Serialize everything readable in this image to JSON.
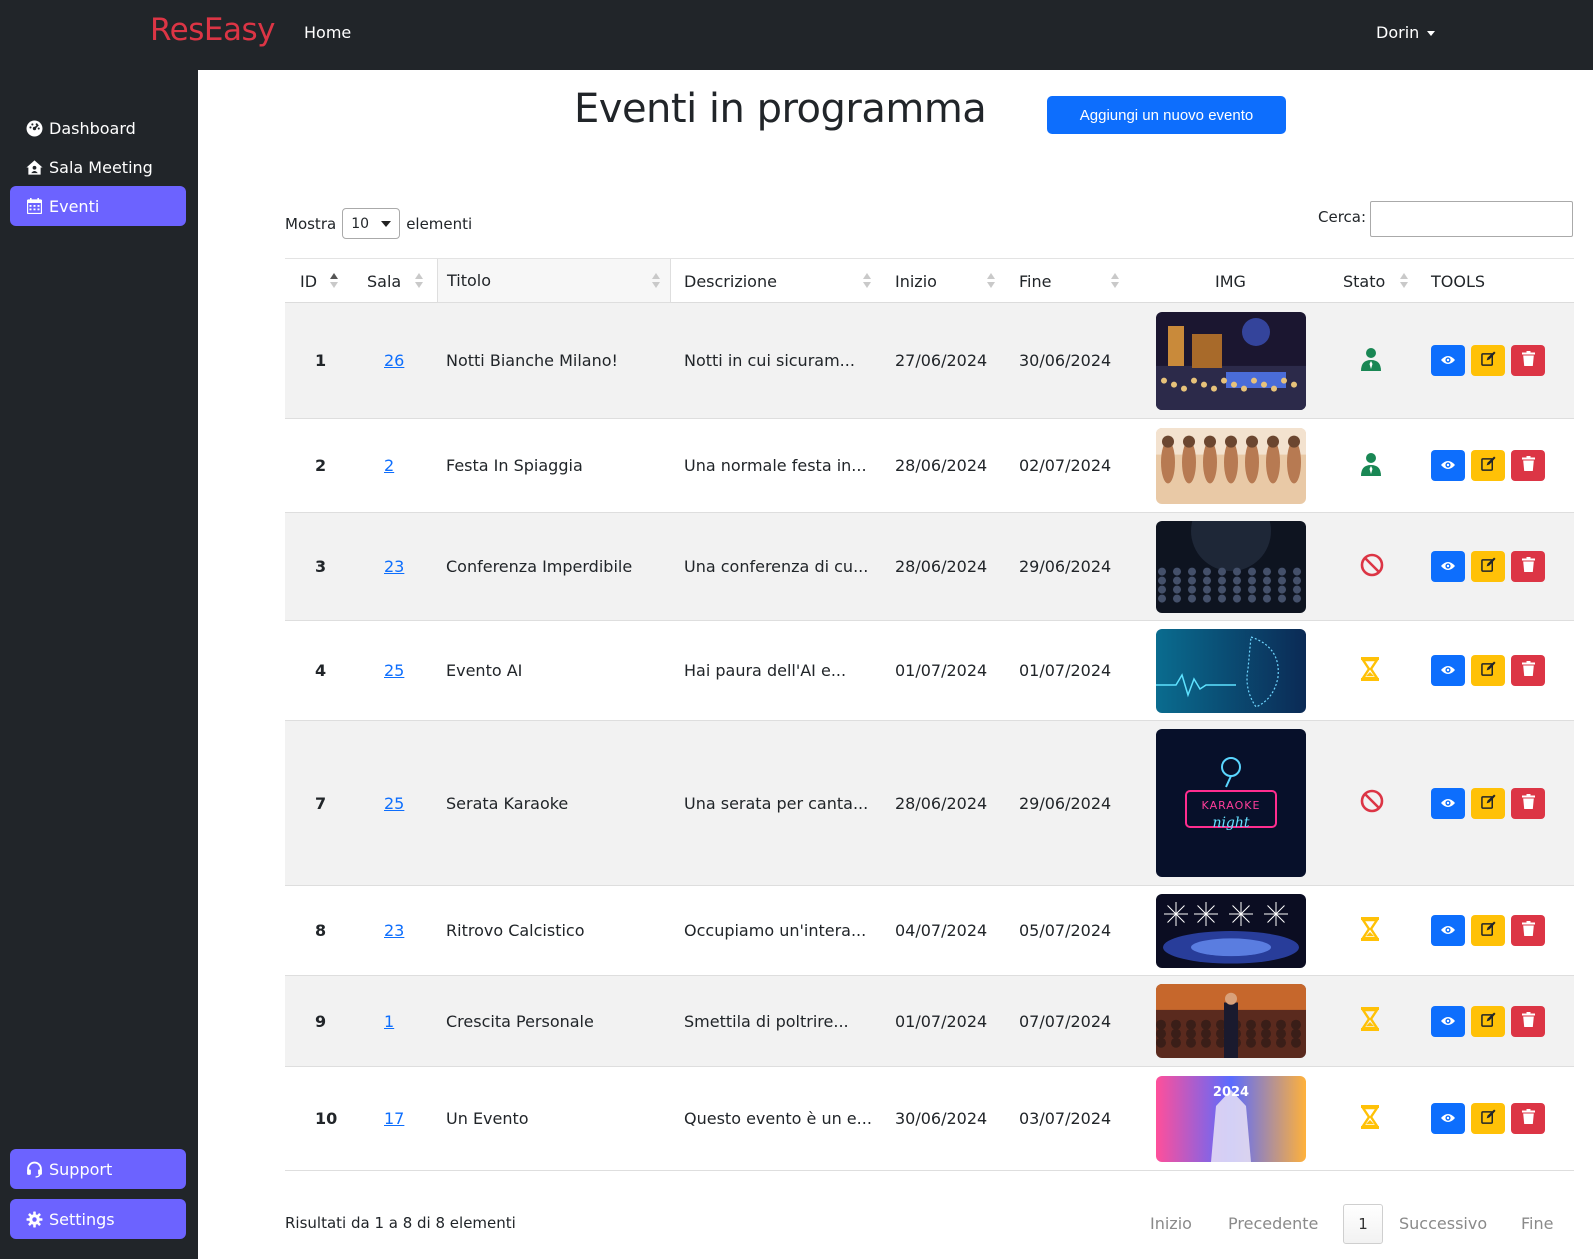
{
  "brand": "ResEasy",
  "nav": {
    "home": "Home",
    "user": "Dorin"
  },
  "sidebar": {
    "items": [
      {
        "label": "Dashboard",
        "icon": "dashboard-icon"
      },
      {
        "label": "Sala Meeting",
        "icon": "house-user-icon"
      },
      {
        "label": "Eventi",
        "icon": "calendar-icon",
        "active": true
      }
    ],
    "bottom": [
      {
        "label": "Support",
        "icon": "headset-icon"
      },
      {
        "label": "Settings",
        "icon": "gear-icon"
      }
    ]
  },
  "page": {
    "title": "Eventi in programma",
    "add_button": "Aggiungi un nuovo evento"
  },
  "controls": {
    "show_prefix": "Mostra",
    "show_value": "10",
    "show_suffix": "elementi",
    "search_label": "Cerca:",
    "search_value": ""
  },
  "table": {
    "columns": [
      "ID",
      "Sala",
      "Titolo",
      "Descrizione",
      "Inizio",
      "Fine",
      "IMG",
      "Stato",
      "TOOLS"
    ],
    "rows": [
      {
        "id": "1",
        "sala": "26",
        "titolo": "Notti Bianche Milano!",
        "descrizione": "Notti in cui sicuram...",
        "inizio": "27/06/2024",
        "fine": "30/06/2024",
        "stato": "active",
        "img": "night-concert"
      },
      {
        "id": "2",
        "sala": "2",
        "titolo": "Festa In Spiaggia",
        "descrizione": "Una normale festa in...",
        "inizio": "28/06/2024",
        "fine": "02/07/2024",
        "stato": "active",
        "img": "beach-party"
      },
      {
        "id": "3",
        "sala": "23",
        "titolo": "Conferenza Imperdibile",
        "descrizione": "Una conferenza di cu...",
        "inizio": "28/06/2024",
        "fine": "29/06/2024",
        "stato": "cancelled",
        "img": "conference-crowd"
      },
      {
        "id": "4",
        "sala": "25",
        "titolo": "Evento AI",
        "descrizione": "Hai paura dell'AI e...",
        "inizio": "01/07/2024",
        "fine": "01/07/2024",
        "stato": "pending",
        "img": "ai-face"
      },
      {
        "id": "7",
        "sala": "25",
        "titolo": "Serata Karaoke",
        "descrizione": "Una serata per canta...",
        "inizio": "28/06/2024",
        "fine": "29/06/2024",
        "stato": "cancelled",
        "img": "karaoke-night",
        "img_text": [
          "KARAOKE",
          "night"
        ]
      },
      {
        "id": "8",
        "sala": "23",
        "titolo": "Ritrovo Calcistico",
        "descrizione": "Occupiamo un'intera...",
        "inizio": "04/07/2024",
        "fine": "05/07/2024",
        "stato": "pending",
        "img": "stadium-fireworks"
      },
      {
        "id": "9",
        "sala": "1",
        "titolo": "Crescita Personale",
        "descrizione": "Smettila di poltrire...",
        "inizio": "01/07/2024",
        "fine": "07/07/2024",
        "stato": "pending",
        "img": "speaker-audience"
      },
      {
        "id": "10",
        "sala": "17",
        "titolo": "Un Evento",
        "descrizione": "Questo evento è un e...",
        "inizio": "30/06/2024",
        "fine": "03/07/2024",
        "stato": "pending",
        "img": "colorful-city",
        "img_text": [
          "2024"
        ]
      }
    ]
  },
  "footer": {
    "info": "Risultati da 1 a 8 di 8 elementi",
    "pager": {
      "first": "Inizio",
      "prev": "Precedente",
      "current": "1",
      "next": "Successivo",
      "last": "Fine"
    }
  },
  "colors": {
    "brand": "#dc3545",
    "sidebar_active": "#6c63ff",
    "primary": "#0d6efd",
    "warning": "#ffc107",
    "danger": "#dc3545",
    "success": "#198754"
  }
}
